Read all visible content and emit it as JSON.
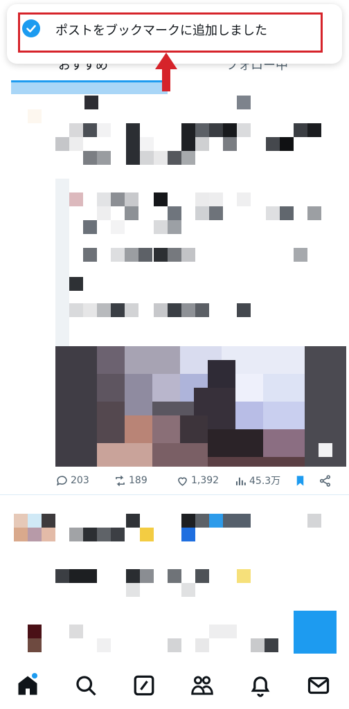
{
  "toast": {
    "message": "ポストをブックマークに追加しました",
    "icon": "check-circle-icon"
  },
  "tabs": [
    {
      "label": "おすすめ",
      "selected": true
    },
    {
      "label": "フォロー中",
      "selected": false
    }
  ],
  "post": {
    "replies": "203",
    "reposts": "189",
    "likes": "1,392",
    "views": "45.3万",
    "bookmarked": true
  },
  "bottom_nav": [
    {
      "name": "home",
      "icon": "home-icon",
      "active": true
    },
    {
      "name": "search",
      "icon": "search-icon"
    },
    {
      "name": "compose",
      "icon": "compose-icon"
    },
    {
      "name": "communities",
      "icon": "people-icon"
    },
    {
      "name": "notifications",
      "icon": "bell-icon"
    },
    {
      "name": "messages",
      "icon": "mail-icon"
    }
  ],
  "colors": {
    "accent": "#1d9bf0",
    "annotation_red": "#d6232a",
    "muted_text": "#536471"
  }
}
